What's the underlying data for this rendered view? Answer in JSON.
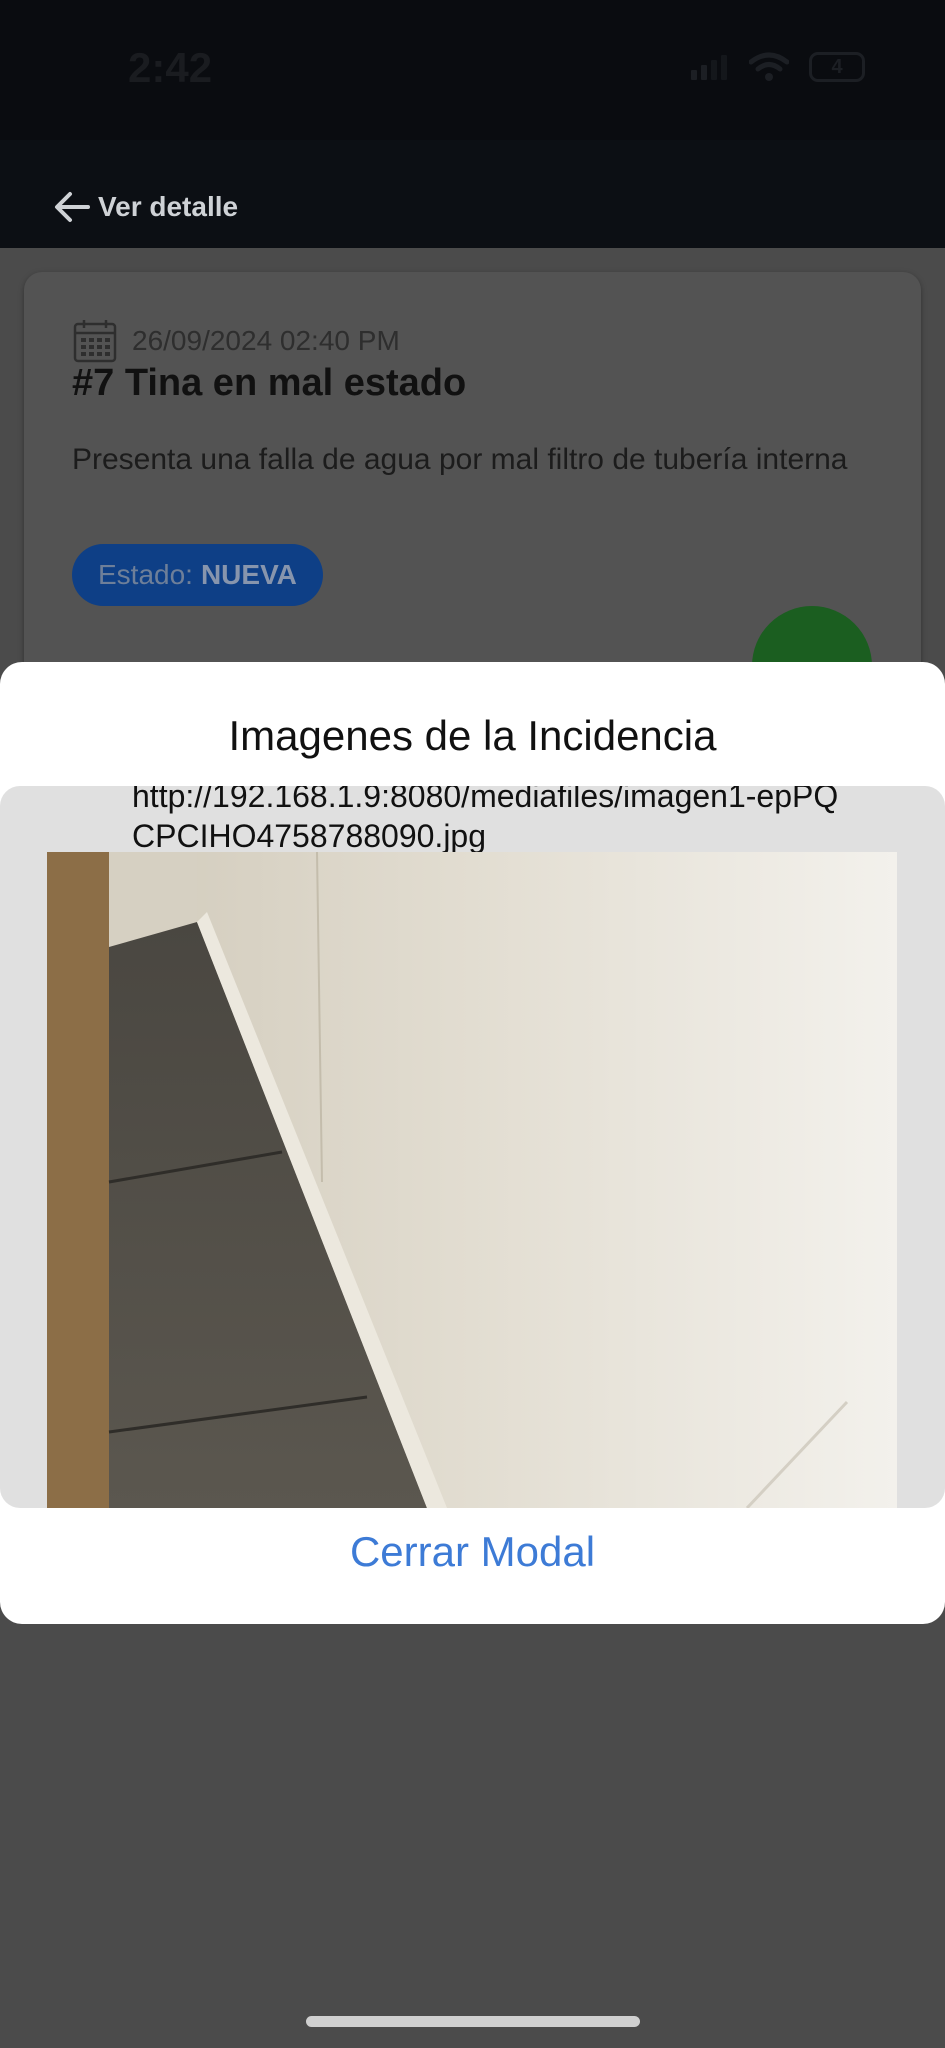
{
  "status_bar": {
    "time": "2:42",
    "battery": "4"
  },
  "header": {
    "back_label": "Ver detalle"
  },
  "incident": {
    "date": "26/09/2024 02:40 PM",
    "title": "#7 Tina en mal estado",
    "description": "Presenta una falla de agua por mal filtro de tubería interna",
    "status_label": "Estado:",
    "status_value": "NUEVA"
  },
  "modal": {
    "title": "Imagenes de la Incidencia",
    "image_url": "http://192.168.1.9:8080/mediafiles/imagen1-epPQCPCIHO4758788090.jpg",
    "close_label": "Cerrar Modal"
  },
  "colors": {
    "accent": "#3d7bd6",
    "badge": "#0e3f86",
    "fab": "#1b5e20"
  }
}
